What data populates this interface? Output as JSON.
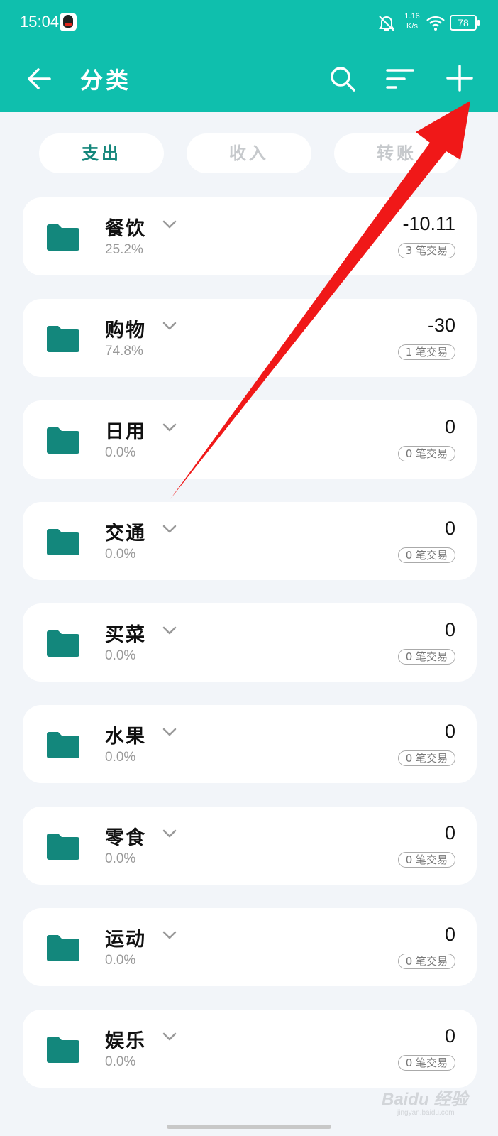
{
  "status_bar": {
    "time": "15:04",
    "net_speed_value": "1.16",
    "net_speed_unit": "K/s",
    "battery": "78"
  },
  "toolbar": {
    "title": "分类",
    "icons": [
      "back-arrow",
      "search",
      "sort",
      "add"
    ]
  },
  "tabs": [
    {
      "label": "支出",
      "active": true
    },
    {
      "label": "收入",
      "active": false
    },
    {
      "label": "转账",
      "active": false
    }
  ],
  "categories": [
    {
      "name": "餐饮",
      "percent": "25.2%",
      "amount": "-10.11",
      "count": "3 笔交易"
    },
    {
      "name": "购物",
      "percent": "74.8%",
      "amount": "-30",
      "count": "1 笔交易"
    },
    {
      "name": "日用",
      "percent": "0.0%",
      "amount": "0",
      "count": "0 笔交易"
    },
    {
      "name": "交通",
      "percent": "0.0%",
      "amount": "0",
      "count": "0 笔交易"
    },
    {
      "name": "买菜",
      "percent": "0.0%",
      "amount": "0",
      "count": "0 笔交易"
    },
    {
      "name": "水果",
      "percent": "0.0%",
      "amount": "0",
      "count": "0 笔交易"
    },
    {
      "name": "零食",
      "percent": "0.0%",
      "amount": "0",
      "count": "0 笔交易"
    },
    {
      "name": "运动",
      "percent": "0.0%",
      "amount": "0",
      "count": "0 笔交易"
    },
    {
      "name": "娱乐",
      "percent": "0.0%",
      "amount": "0",
      "count": "0 笔交易"
    }
  ],
  "watermark": {
    "text": "Baidu 经验",
    "sub": "jingyan.baidu.com"
  },
  "colors": {
    "accent": "#0fbfad",
    "folder": "#13877c",
    "arrow": "#f01818"
  }
}
